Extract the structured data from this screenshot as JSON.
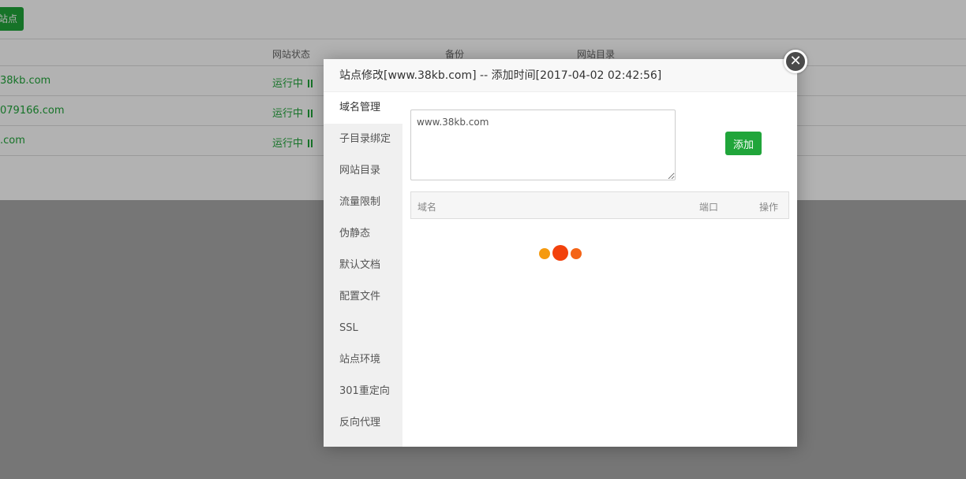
{
  "background": {
    "top_button": "站点",
    "columns": [
      "网站状态",
      "备份",
      "网站目录"
    ],
    "rows": [
      {
        "site": "38kb.com",
        "status": "运行中"
      },
      {
        "site": "079166.com",
        "status": "运行中"
      },
      {
        "site": ".com",
        "status": "运行中"
      }
    ]
  },
  "modal": {
    "title": "站点修改[www.38kb.com] -- 添加时间[2017-04-02 02:42:56]",
    "close_icon": "close-icon",
    "tabs": [
      "域名管理",
      "子目录绑定",
      "网站目录",
      "流量限制",
      "伪静态",
      "默认文档",
      "配置文件",
      "SSL",
      "站点环境",
      "301重定向",
      "反向代理"
    ],
    "active_tab": 0,
    "domain_input_value": "www.38kb.com",
    "add_button": "添加",
    "table_headers": {
      "domain": "域名",
      "port": "端口",
      "action": "操作"
    },
    "loader_colors": [
      "#f59a0f",
      "#f2410c",
      "#f46417"
    ]
  },
  "colors": {
    "accent": "#20a53a"
  }
}
